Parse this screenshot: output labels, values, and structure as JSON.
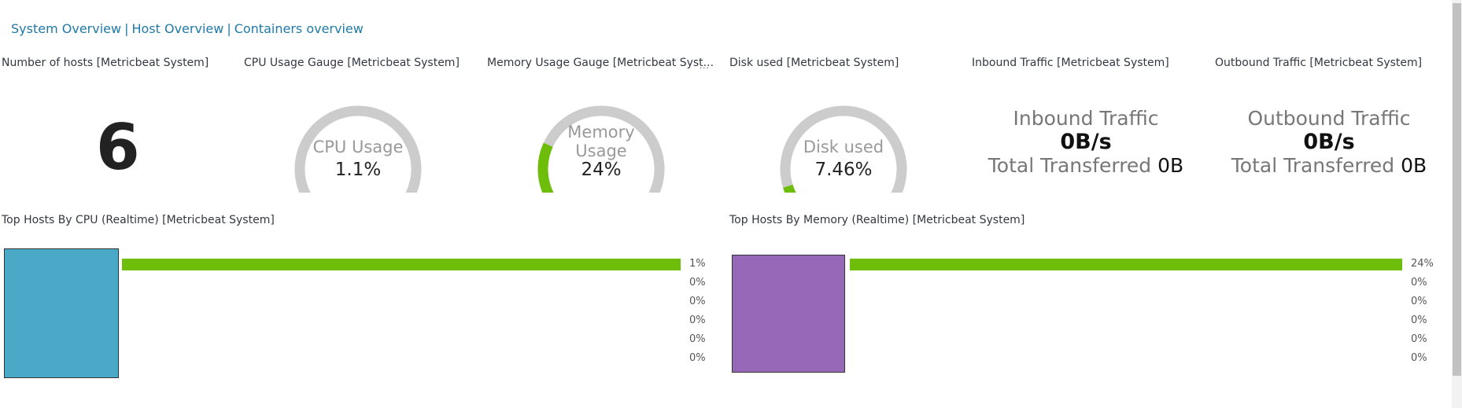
{
  "nav": {
    "links": [
      "System Overview",
      "Host Overview",
      "Containers overview"
    ],
    "separator": "|"
  },
  "panels": {
    "hosts": {
      "title": "Number of hosts [Metricbeat System]",
      "value": "6"
    },
    "cpu_gauge": {
      "title": "CPU Usage Gauge [Metricbeat System]",
      "label": "CPU Usage",
      "value": "1.1%",
      "fraction": 0.011
    },
    "mem_gauge": {
      "title": "Memory Usage Gauge [Metricbeat Syst...",
      "menu": "...",
      "label_line1": "Memory",
      "label_line2": "Usage",
      "value": "24%",
      "fraction": 0.24
    },
    "disk_gauge": {
      "title": "Disk used [Metricbeat System]",
      "label": "Disk used",
      "value": "7.46%",
      "fraction": 0.0746
    },
    "inbound": {
      "title": "Inbound Traffic [Metricbeat System]",
      "heading": "Inbound Traffic",
      "rate": "0B/s",
      "total_label": "Total Transferred",
      "total_value": "0B"
    },
    "outbound": {
      "title": "Outbound Traffic [Metricbeat System]",
      "heading": "Outbound Traffic",
      "rate": "0B/s",
      "total_label": "Total Transferred",
      "total_value": "0B"
    },
    "top_cpu": {
      "title": "Top Hosts By CPU (Realtime) [Metricbeat System]",
      "legend_color": "#4ba9c8",
      "bar_color": "#6dbd0a",
      "values": [
        "1%",
        "0%",
        "0%",
        "0%",
        "0%",
        "0%"
      ],
      "fractions": [
        1,
        0,
        0,
        0,
        0,
        0
      ]
    },
    "top_mem": {
      "title": "Top Hosts By Memory (Realtime) [Metricbeat System]",
      "legend_color": "#9868b8",
      "bar_color": "#6dbd0a",
      "values": [
        "24%",
        "0%",
        "0%",
        "0%",
        "0%",
        "0%"
      ],
      "fractions": [
        1,
        0,
        0,
        0,
        0,
        0
      ]
    }
  },
  "colors": {
    "gauge_track": "#cccccc",
    "gauge_fill": "#6dbd0a",
    "link": "#1f7aa5"
  }
}
